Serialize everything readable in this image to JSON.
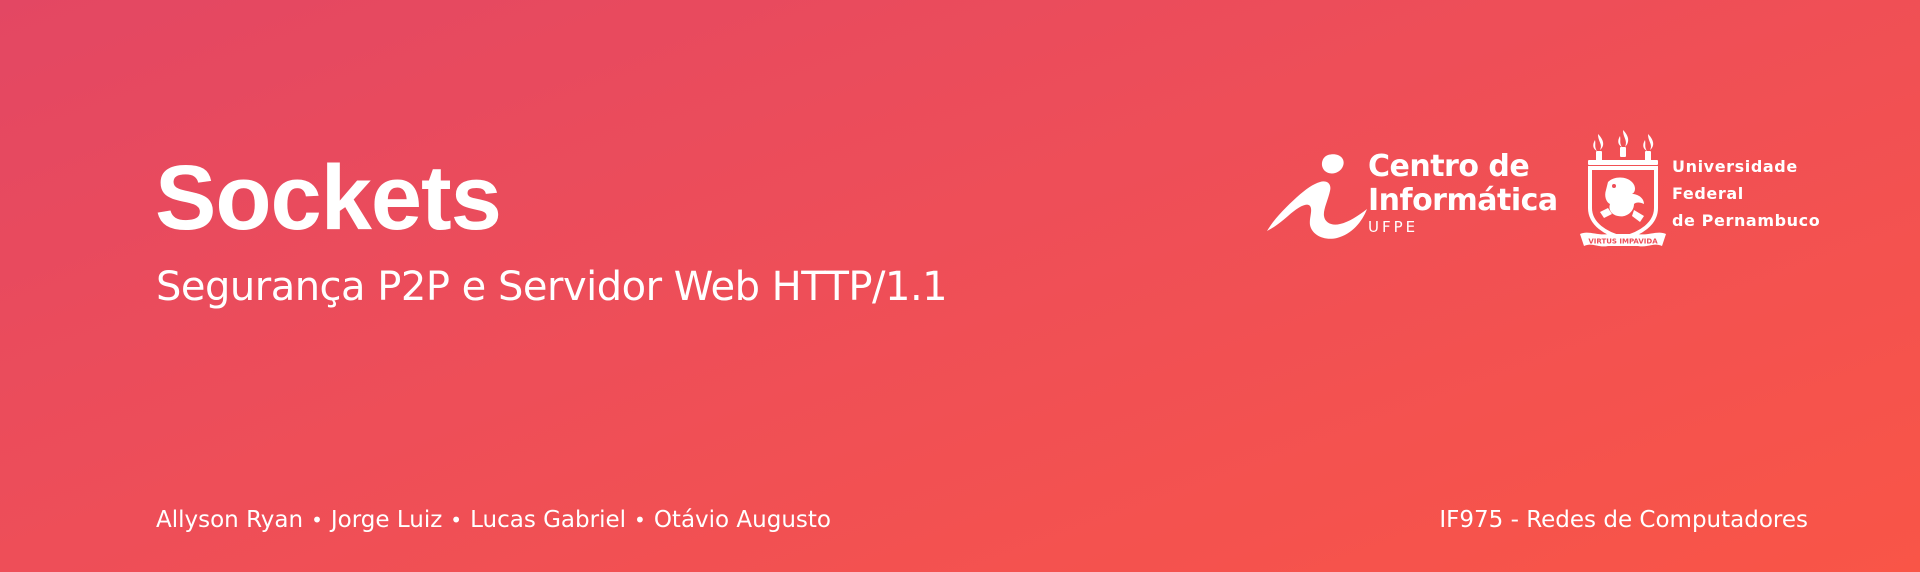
{
  "slide": {
    "title": "Sockets",
    "subtitle": "Segurança P2P e Servidor Web HTTP/1.1",
    "authors": [
      "Allyson Ryan",
      "Jorge Luiz",
      "Lucas Gabriel",
      "Otávio Augusto"
    ],
    "author_separator": "•",
    "course": "IF975 - Redes de Computadores"
  },
  "logos": {
    "cin": {
      "line1": "Centro de",
      "line2": "Informática",
      "line3": "UFPE"
    },
    "ufpe": {
      "line1": "Universidade",
      "line2": "Federal",
      "line3": "de Pernambuco",
      "motto": "VIRTUS IMPAVIDA"
    }
  },
  "colors": {
    "gradient_start": "#e34763",
    "gradient_end": "#f95547",
    "text": "#ffffff"
  }
}
